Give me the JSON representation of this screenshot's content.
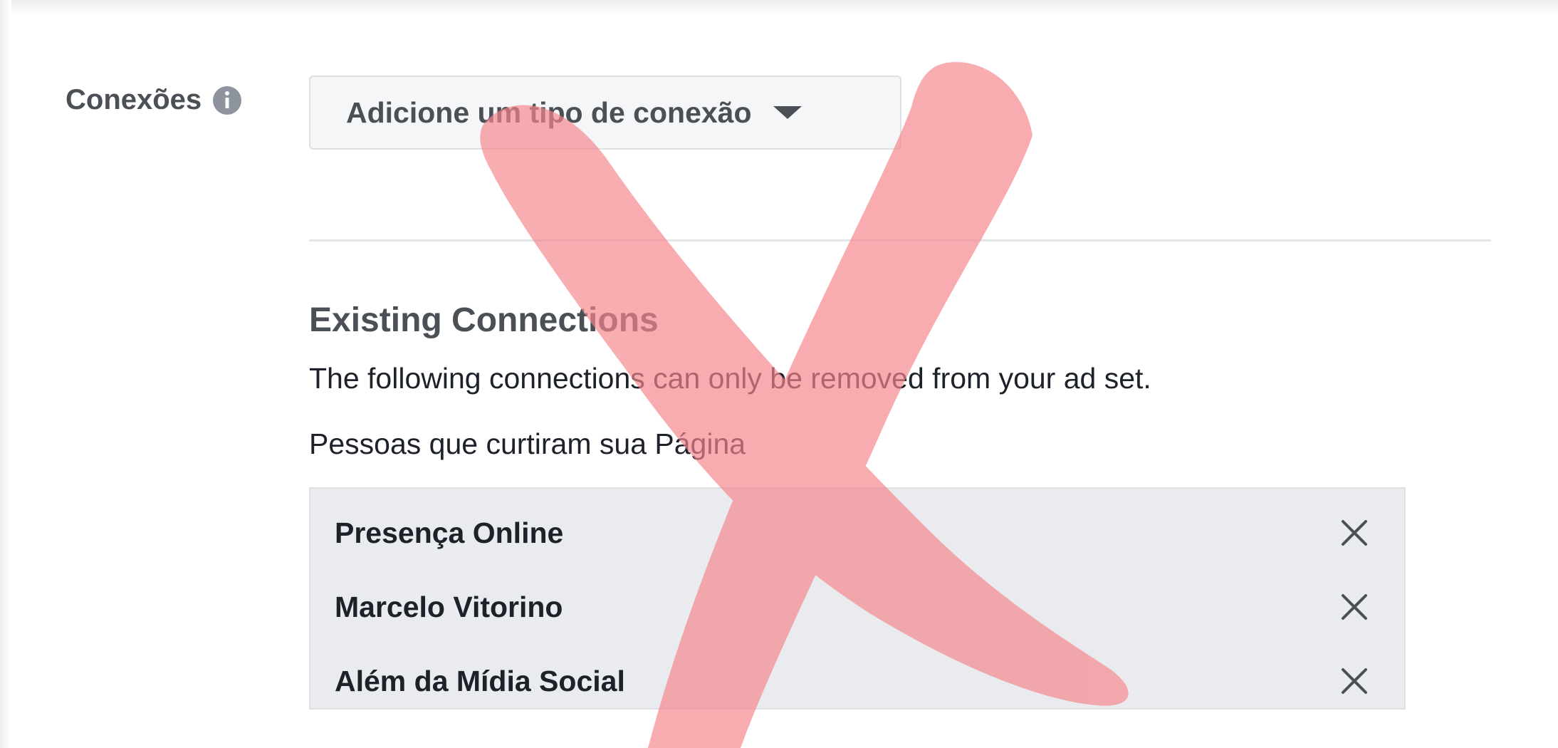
{
  "connections": {
    "label": "Conexões",
    "info_icon": "info-icon",
    "dropdown": {
      "label": "Adicione um tipo de conexão",
      "icon": "caret-down-icon"
    }
  },
  "existing": {
    "title": "Existing Connections",
    "description": "The following connections can only be removed from your ad set.",
    "group_label": "Pessoas que curtiram sua Página",
    "items": [
      {
        "label": "Presença Online"
      },
      {
        "label": "Marcelo Vitorino"
      },
      {
        "label": "Além da Mídia Social"
      }
    ],
    "remove_icon": "close-icon"
  },
  "overlay": {
    "icon": "red-x-mark-icon",
    "color": "#f5868c"
  },
  "colors": {
    "text_dark": "#1d2129",
    "text_gray": "#4b4f56",
    "list_bg": "#e9ebee",
    "button_bg": "#f5f6f7"
  }
}
